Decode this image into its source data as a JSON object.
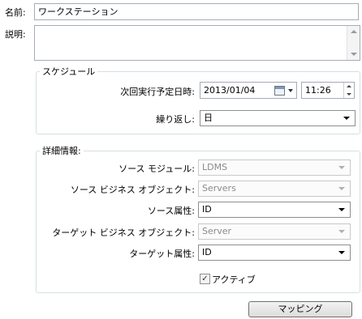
{
  "name": {
    "label": "名前:",
    "value": "ワークステーション"
  },
  "description": {
    "label": "説明:",
    "value": ""
  },
  "schedule": {
    "title": "スケジュール",
    "next_run_label": "次回実行予定日時:",
    "date": "2013/01/04",
    "time": "11:26",
    "repeat_label": "繰り返し:",
    "repeat_value": "日"
  },
  "details": {
    "title": "詳細情報:",
    "source_module_label": "ソース モジュール:",
    "source_module_value": "LDMS",
    "source_bo_label": "ソース ビジネス オブジェクト:",
    "source_bo_value": "Servers",
    "source_attr_label": "ソース属性:",
    "source_attr_value": "ID",
    "target_bo_label": "ターゲット ビジネス オブジェクト:",
    "target_bo_value": "Server",
    "target_attr_label": "ターゲット属性:",
    "target_attr_value": "ID",
    "active_label": "アクティブ",
    "active_checked": true
  },
  "mapping_button": "マッピング"
}
